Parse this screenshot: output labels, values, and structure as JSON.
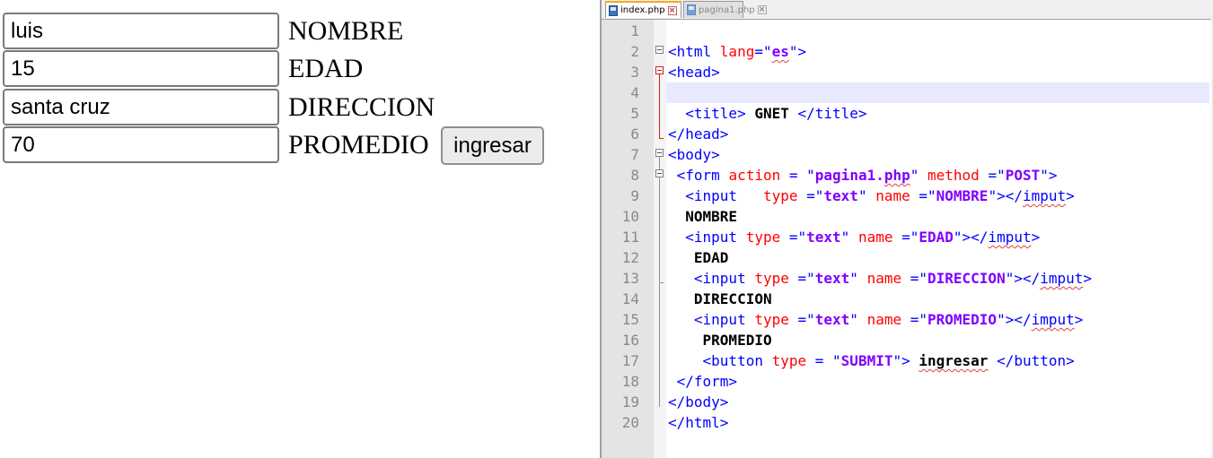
{
  "form": {
    "fields": [
      {
        "value": "luis",
        "label": "NOMBRE"
      },
      {
        "value": "15",
        "label": "EDAD"
      },
      {
        "value": "santa cruz",
        "label": "DIRECCION"
      },
      {
        "value": "70",
        "label": "PROMEDIO"
      }
    ],
    "submit_label": "ingresar"
  },
  "editor": {
    "tabs": [
      {
        "label": "index.php",
        "active": true
      },
      {
        "label": "pagina1.php",
        "active": false
      }
    ],
    "lines": [
      {
        "n": "1",
        "tokens": []
      },
      {
        "n": "2",
        "tokens": [
          [
            "t",
            "<html "
          ],
          [
            "a",
            "lang"
          ],
          [
            "t",
            "=\""
          ],
          [
            "sq",
            "es"
          ],
          [
            "t",
            "\">"
          ]
        ]
      },
      {
        "n": "3",
        "tokens": [
          [
            "t",
            "<head>"
          ]
        ]
      },
      {
        "n": "4",
        "tokens": []
      },
      {
        "n": "5",
        "tokens": [
          [
            "t",
            "  <title> "
          ],
          [
            "p",
            "GNET"
          ],
          [
            "t",
            " </title>"
          ]
        ]
      },
      {
        "n": "6",
        "tokens": [
          [
            "t",
            "</head>"
          ]
        ]
      },
      {
        "n": "7",
        "tokens": [
          [
            "t",
            "<body>"
          ]
        ]
      },
      {
        "n": "8",
        "tokens": [
          [
            "t",
            " <form "
          ],
          [
            "a",
            "action "
          ],
          [
            "t",
            "= \""
          ],
          [
            "s",
            "pagina1."
          ],
          [
            "sq",
            "php"
          ],
          [
            "t",
            "\" "
          ],
          [
            "a",
            "method "
          ],
          [
            "t",
            "=\""
          ],
          [
            "s",
            "POST"
          ],
          [
            "t",
            "\">"
          ]
        ]
      },
      {
        "n": "9",
        "tokens": [
          [
            "t",
            "  <input   "
          ],
          [
            "a",
            "type "
          ],
          [
            "t",
            "=\""
          ],
          [
            "s",
            "text"
          ],
          [
            "t",
            "\" "
          ],
          [
            "a",
            "name "
          ],
          [
            "t",
            "=\""
          ],
          [
            "s",
            "NOMBRE"
          ],
          [
            "t",
            "\"></"
          ],
          [
            "sqt",
            "imput"
          ],
          [
            "t",
            ">"
          ]
        ]
      },
      {
        "n": "10",
        "tokens": [
          [
            "p",
            "  NOMBRE"
          ]
        ]
      },
      {
        "n": "11",
        "tokens": [
          [
            "t",
            "  <input "
          ],
          [
            "a",
            "type "
          ],
          [
            "t",
            "=\""
          ],
          [
            "s",
            "text"
          ],
          [
            "t",
            "\" "
          ],
          [
            "a",
            "name "
          ],
          [
            "t",
            "=\""
          ],
          [
            "s",
            "EDAD"
          ],
          [
            "t",
            "\"></"
          ],
          [
            "sqt",
            "imput"
          ],
          [
            "t",
            ">"
          ]
        ]
      },
      {
        "n": "12",
        "tokens": [
          [
            "p",
            "   EDAD"
          ]
        ]
      },
      {
        "n": "13",
        "tokens": [
          [
            "t",
            "   <input "
          ],
          [
            "a",
            "type "
          ],
          [
            "t",
            "=\""
          ],
          [
            "s",
            "text"
          ],
          [
            "t",
            "\" "
          ],
          [
            "a",
            "name "
          ],
          [
            "t",
            "=\""
          ],
          [
            "s",
            "DIRECCION"
          ],
          [
            "t",
            "\"></"
          ],
          [
            "sqt",
            "imput"
          ],
          [
            "t",
            ">"
          ]
        ]
      },
      {
        "n": "14",
        "tokens": [
          [
            "p",
            "   DIRECCION"
          ]
        ]
      },
      {
        "n": "15",
        "tokens": [
          [
            "t",
            "   <input "
          ],
          [
            "a",
            "type "
          ],
          [
            "t",
            "=\""
          ],
          [
            "s",
            "text"
          ],
          [
            "t",
            "\" "
          ],
          [
            "a",
            "name "
          ],
          [
            "t",
            "=\""
          ],
          [
            "s",
            "PROMEDIO"
          ],
          [
            "t",
            "\"></"
          ],
          [
            "sqt",
            "imput"
          ],
          [
            "t",
            ">"
          ]
        ]
      },
      {
        "n": "16",
        "tokens": [
          [
            "p",
            "    PROMEDIO"
          ]
        ]
      },
      {
        "n": "17",
        "tokens": [
          [
            "t",
            "    <button "
          ],
          [
            "a",
            "type "
          ],
          [
            "t",
            "= \""
          ],
          [
            "s",
            "SUBMIT"
          ],
          [
            "t",
            "\"> "
          ],
          [
            "sqp",
            "ingresar"
          ],
          [
            "t",
            " </button>"
          ]
        ]
      },
      {
        "n": "18",
        "tokens": [
          [
            "t",
            " </form>"
          ]
        ]
      },
      {
        "n": "19",
        "tokens": [
          [
            "t",
            "</body>"
          ]
        ]
      },
      {
        "n": "20",
        "tokens": [
          [
            "t",
            "</html>"
          ]
        ]
      }
    ]
  }
}
